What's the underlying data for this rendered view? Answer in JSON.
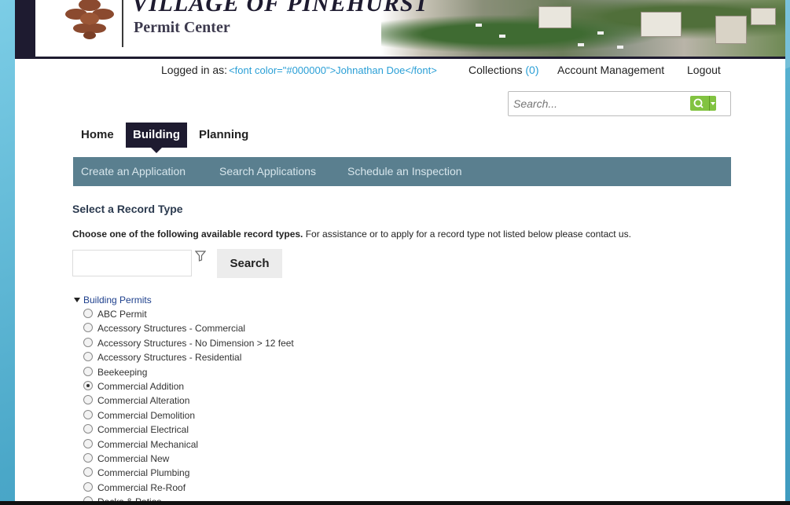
{
  "header": {
    "org_name": "VILLAGE OF PINEHURST",
    "subtitle": "Permit Center"
  },
  "top_links": {
    "logged_in_label": "Logged in as:",
    "user_display": "<font color=\"#000000\">Johnathan Doe</font>",
    "collections_label": "Collections",
    "collections_count": "(0)",
    "account_management": "Account Management",
    "logout": "Logout"
  },
  "search": {
    "placeholder": "Search..."
  },
  "tabs": [
    {
      "label": "Home",
      "active": false
    },
    {
      "label": "Building",
      "active": true
    },
    {
      "label": "Planning",
      "active": false
    }
  ],
  "subnav": [
    {
      "label": "Create an Application"
    },
    {
      "label": "Search Applications"
    },
    {
      "label": "Schedule an Inspection"
    }
  ],
  "main": {
    "section_title": "Select a Record Type",
    "instructions_bold": "Choose one of the following available record types.",
    "instructions_rest": " For assistance or to apply for a record type not listed below please contact us.",
    "search_button": "Search",
    "group_label": "Building Permits",
    "records": [
      {
        "label": "ABC Permit",
        "selected": false
      },
      {
        "label": "Accessory Structures - Commercial",
        "selected": false
      },
      {
        "label": "Accessory Structures - No Dimension > 12 feet",
        "selected": false
      },
      {
        "label": "Accessory Structures - Residential",
        "selected": false
      },
      {
        "label": "Beekeeping",
        "selected": false
      },
      {
        "label": "Commercial Addition",
        "selected": true
      },
      {
        "label": "Commercial Alteration",
        "selected": false
      },
      {
        "label": "Commercial Demolition",
        "selected": false
      },
      {
        "label": "Commercial Electrical",
        "selected": false
      },
      {
        "label": "Commercial Mechanical",
        "selected": false
      },
      {
        "label": "Commercial New",
        "selected": false
      },
      {
        "label": "Commercial Plumbing",
        "selected": false
      },
      {
        "label": "Commercial Re-Roof",
        "selected": false
      },
      {
        "label": "Decks & Patios",
        "selected": false
      }
    ]
  },
  "colors": {
    "banner": "#1e1b30",
    "subnav": "#5a7f8f",
    "search_button": "#82c341",
    "link": "#2a9fd6"
  }
}
